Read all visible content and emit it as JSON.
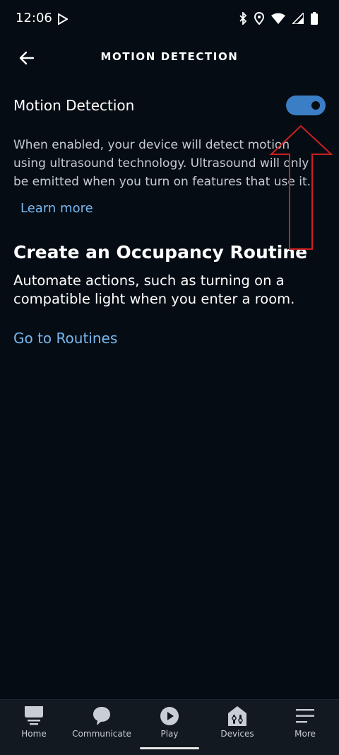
{
  "status_bar": {
    "time": "12:06",
    "icons": [
      "play-store-icon",
      "bluetooth-icon",
      "location-icon",
      "wifi-icon",
      "signal-icon",
      "battery-icon"
    ]
  },
  "header": {
    "back_icon": "arrow-left-icon",
    "title": "MOTION DETECTION"
  },
  "motion_setting": {
    "label": "Motion Detection",
    "enabled": true,
    "description": "When enabled, your device will detect motion using ultrasound technology. Ultrasound will only be emitted when you turn on features that use it.",
    "learn_more": "Learn more"
  },
  "routine_section": {
    "heading": "Create an Occupancy Routine",
    "description": "Automate actions, such as turning on a compatible light when you enter a room.",
    "link": "Go to Routines"
  },
  "bottom_nav": {
    "items": [
      {
        "label": "Home",
        "icon": "home-icon"
      },
      {
        "label": "Communicate",
        "icon": "chat-bubble-icon"
      },
      {
        "label": "Play",
        "icon": "play-icon",
        "active": true
      },
      {
        "label": "Devices",
        "icon": "devices-icon"
      },
      {
        "label": "More",
        "icon": "menu-icon"
      }
    ]
  },
  "colors": {
    "background": "#050c14",
    "accent": "#3c7ec6",
    "link": "#7ab8ef",
    "annotation": "#cc1f1f"
  }
}
